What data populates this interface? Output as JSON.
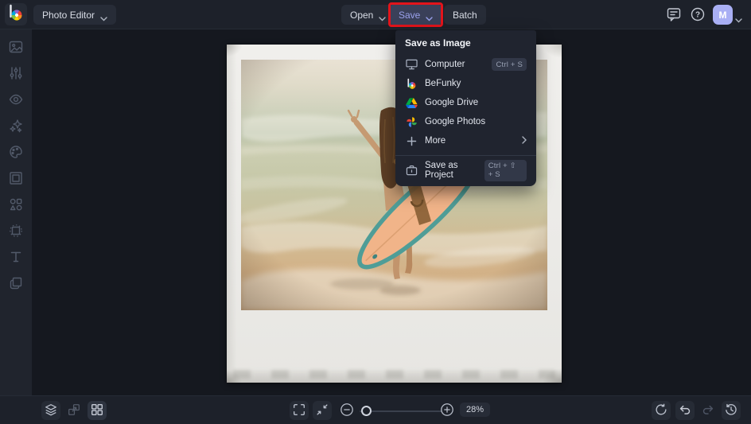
{
  "app": {
    "name": "BeFunky",
    "logo_icon": "befunky-logo-icon"
  },
  "topbar": {
    "mode_button": "Photo Editor",
    "open_button": "Open",
    "save_button": "Save",
    "batch_button": "Batch",
    "avatar_initial": "M",
    "icons": [
      "feedback-icon",
      "help-icon",
      "chevron-down-icon"
    ]
  },
  "save_menu": {
    "header": "Save as Image",
    "items": [
      {
        "label": "Computer",
        "icon": "computer-icon",
        "shortcut": "Ctrl + S"
      },
      {
        "label": "BeFunky",
        "icon": "befunky-icon"
      },
      {
        "label": "Google Drive",
        "icon": "google-drive-icon"
      },
      {
        "label": "Google Photos",
        "icon": "google-photos-icon"
      },
      {
        "label": "More",
        "icon": "plus-icon",
        "has_submenu": true
      }
    ],
    "project_item": {
      "label": "Save as Project",
      "icon": "project-icon",
      "shortcut": "Ctrl + ⇧ + S"
    }
  },
  "sidebar": {
    "items": [
      {
        "icon": "image-edit-icon"
      },
      {
        "icon": "adjustments-icon"
      },
      {
        "icon": "eye-icon"
      },
      {
        "icon": "effects-sparkle-icon"
      },
      {
        "icon": "artsy-palette-icon"
      },
      {
        "icon": "frame-icon"
      },
      {
        "icon": "graphics-shapes-icon"
      },
      {
        "icon": "overlay-icon"
      },
      {
        "icon": "text-icon"
      },
      {
        "icon": "textures-icon"
      }
    ]
  },
  "bottombar": {
    "zoom_percent": "28%"
  },
  "colors": {
    "accent_purple": "#9aa1ec",
    "annotation_red": "#e2141b",
    "avatar_bg": "#a9aff4",
    "topbar_bg": "#1d212a",
    "canvas_bg": "#15181f",
    "menu_bg": "#20242f"
  }
}
